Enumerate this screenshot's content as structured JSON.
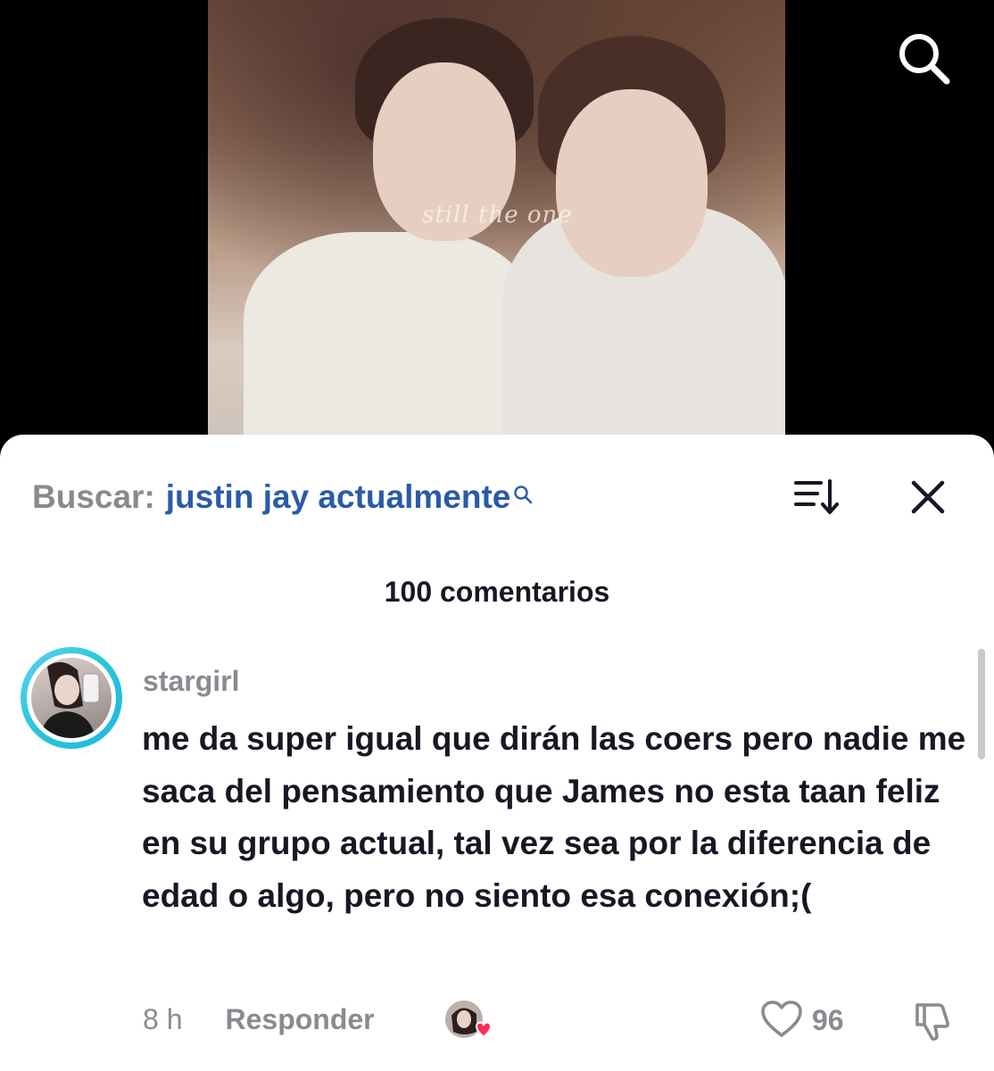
{
  "video": {
    "caption": "still the one",
    "search_icon": "search-icon"
  },
  "sheet": {
    "search_prefix": "Buscar:",
    "search_query": "justin jay actualmente",
    "search_query_icon": "search-icon",
    "sort_icon": "sort-icon",
    "close_icon": "close-icon",
    "comment_count": "100 comentarios"
  },
  "comment": {
    "username": "stargirl",
    "text": "me da super igual que dirán las coers pero nadie me saca del pensamiento que James no esta taan feliz en su grupo actual, tal vez sea por la diferencia de edad o algo, pero no siento esa conexión;(",
    "time": "8 h",
    "reply_label": "Responder",
    "like_count": "96",
    "like_icon": "heart-outline-icon",
    "dislike_icon": "thumbs-down-icon"
  },
  "colors": {
    "accent_link": "#2b5aa8",
    "muted": "#8a8b91",
    "text": "#161823",
    "avatar_ring": "#29c5d6",
    "liked_heart": "#fe2c55"
  }
}
